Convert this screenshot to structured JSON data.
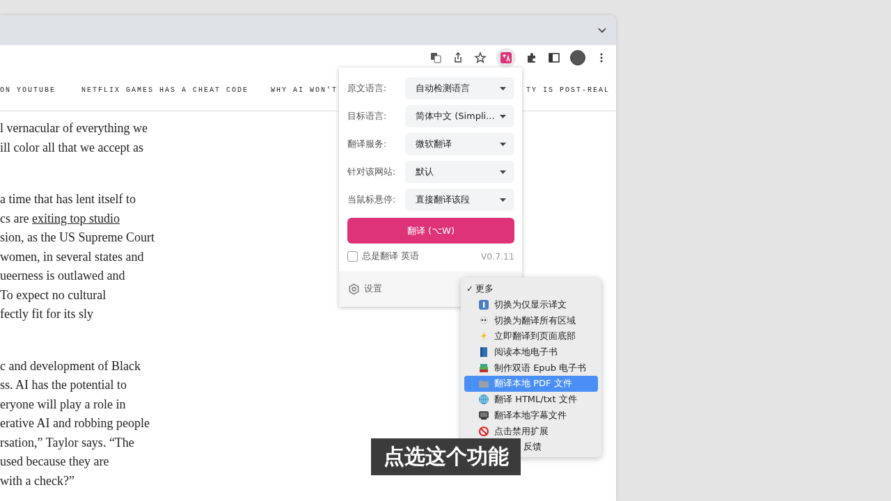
{
  "nav": [
    {
      "label": "ON YOUTUBE"
    },
    {
      "label": "NETFLIX GAMES HAS A CHEAT CODE"
    },
    {
      "label": "WHY AI WON'T"
    },
    {
      "label": "TY IS POST-REAL"
    }
  ],
  "article": {
    "paragraphs": [
      [
        "l vernacular of everything we",
        "ill color all that we accept as"
      ],
      [
        "a time that has lent itself to",
        {
          "text": "cs are ",
          "link": "exiting top studio"
        },
        "sion, as the US Supreme Court",
        "women, in several states and",
        "ueerness is outlawed and",
        "To expect no cultural",
        "fectly fit for its sly"
      ],
      [
        "c and development of Black",
        "ss. AI has the potential to",
        "eryone will play a role in",
        "erative AI and robbing people",
        "rsation,” Taylor says. “The",
        "used because they are",
        "with a check?”"
      ]
    ]
  },
  "popup": {
    "fields": [
      {
        "label": "原文语言:",
        "value": "自动检测语言"
      },
      {
        "label": "目标语言:",
        "value": "简体中文 (Simpli..."
      },
      {
        "label": "翻译服务:",
        "value": "微软翻译"
      },
      {
        "label": "针对该网站:",
        "value": "默认"
      },
      {
        "label": "当鼠标悬停:",
        "value": "直接翻译该段"
      }
    ],
    "translate_button": "翻译 (⌥W)",
    "always_translate": {
      "label": "总是翻译 英语",
      "checked": false
    },
    "version": "V0.7.11",
    "settings": "设置"
  },
  "menu": {
    "header": {
      "check_mark": "✓",
      "label": "更多",
      "checked": true
    },
    "items": [
      {
        "label": "切换为仅显示译文",
        "selected": false
      },
      {
        "label": "切换为翻译所有区域",
        "selected": false
      },
      {
        "label": "立即翻译到页面底部",
        "selected": false
      },
      {
        "label": "阅读本地电子书",
        "selected": false
      },
      {
        "label": "制作双语 Epub 电子书",
        "selected": false
      },
      {
        "label": "翻译本地 PDF 文件",
        "selected": true
      },
      {
        "label": "翻译 HTML/txt 文件",
        "selected": false
      },
      {
        "label": "翻译本地字幕文件",
        "selected": false
      },
      {
        "label": "点击禁用扩展",
        "selected": false
      },
      {
        "label": "反馈",
        "selected": false,
        "kind": "covered"
      }
    ]
  },
  "subtitle": "点选这个功能"
}
